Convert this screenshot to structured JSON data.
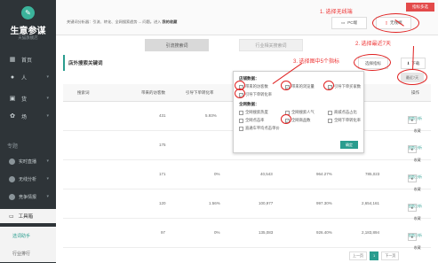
{
  "sidebar": {
    "logo_title": "生意参谋",
    "logo_sub": "天猫旗舰店",
    "items": [
      {
        "label": "首页"
      },
      {
        "label": "人"
      },
      {
        "label": "货"
      },
      {
        "label": "场"
      }
    ],
    "section_label": "专题",
    "sub_items": [
      {
        "label": "实时直播"
      },
      {
        "label": "无线分析"
      },
      {
        "label": "竞争情报"
      }
    ],
    "tools_label": "工具箱",
    "tool_items": [
      {
        "label": "选词助手"
      },
      {
        "label": "行业排行"
      }
    ]
  },
  "topbar": {
    "description_prefix": "关键词分析器：引流、转化、全网搜索趋势 ... 问题。进入",
    "description_link": "我的收藏",
    "pc_label": "PC端",
    "wireless_label": "无线端",
    "red_tag": "指标多选"
  },
  "tabs": [
    {
      "label": "引流搜索词"
    },
    {
      "label": "行业相关搜索词"
    }
  ],
  "section": {
    "title": "店外搜索关键词",
    "select_button": "选择指标",
    "download_button": "下载",
    "date_button": "最近7天"
  },
  "table": {
    "headers": [
      "搜索词",
      "带来的访客数",
      "引导下单转化率",
      "",
      "",
      "",
      "操作"
    ],
    "rows": [
      {
        "c1": "431",
        "c2": "5.93%",
        "c3": "",
        "c4": "",
        "c5": "",
        "op_link": "趋势分析",
        "op_star": "收藏"
      },
      {
        "c1": "175",
        "c2": "",
        "c3": "",
        "c4": "",
        "c5": "",
        "op_link": "趋势分析",
        "op_star": "收藏"
      },
      {
        "c1": "171",
        "c2": "0%",
        "c3": "40,543",
        "c4": "964.27%",
        "c5": "785,023",
        "op_link": "趋势分析",
        "op_star": "收藏"
      },
      {
        "c1": "120",
        "c2": "1.56%",
        "c3": "100,977",
        "c4": "997.30%",
        "c5": "2,654,161",
        "op_link": "趋势分析",
        "op_star": "收藏"
      },
      {
        "c1": "97",
        "c2": "0%",
        "c3": "135,083",
        "c4": "926.40%",
        "c5": "2,183,894",
        "op_link": "趋势分析",
        "op_star": "收藏"
      }
    ]
  },
  "pager": {
    "prev": "上一页",
    "current": "1",
    "next": "下一页"
  },
  "popup": {
    "shop_title": "店铺数据：",
    "shop_options": [
      {
        "label": "带来的访客数",
        "checked": true
      },
      {
        "label": "带来的浏览量",
        "checked": true
      },
      {
        "label": "引导下单买家数",
        "checked": true
      },
      {
        "label": "引导下单转化率",
        "checked": true
      }
    ],
    "net_title": "全网数据：",
    "net_options": [
      {
        "label": "全网搜索热度",
        "checked": false
      },
      {
        "label": "全网搜索人气",
        "checked": false
      },
      {
        "label": "商城点击占比",
        "checked": false
      },
      {
        "label": "全网点击率",
        "checked": false
      },
      {
        "label": "全网商品数",
        "checked": true
      },
      {
        "label": "全网下单转化率",
        "checked": false
      },
      {
        "label": "直通车平均点击单价",
        "checked": false
      }
    ],
    "confirm": "确定"
  },
  "annotations": {
    "step1": "1. 选择无线端",
    "step2": "2. 选择最近7天",
    "step3": "3. 选择图中5个指标"
  },
  "colors": {
    "accent": "#2a9d8f",
    "annotation": "#e02020",
    "sidebar": "#2e3438"
  }
}
